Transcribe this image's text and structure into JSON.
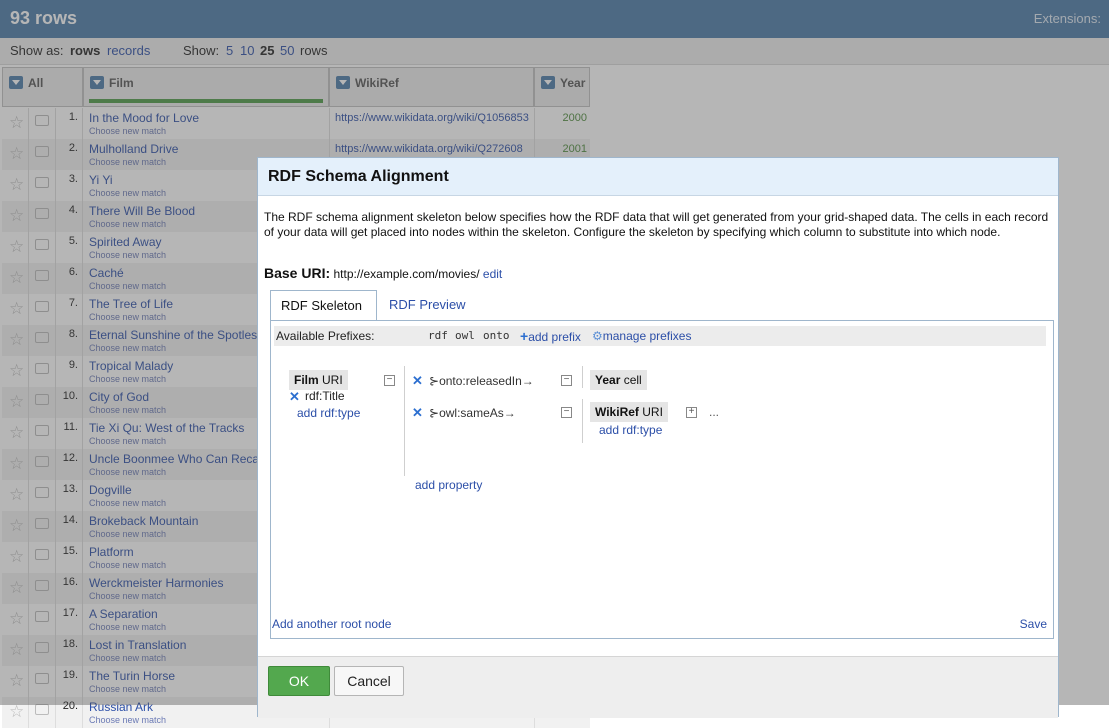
{
  "header": {
    "row_count": "93 rows",
    "extensions": "Extensions:"
  },
  "showbar": {
    "show_as_label": "Show as:",
    "rows_label": "rows",
    "records_label": "records",
    "show_label": "Show:",
    "page_sizes": [
      "5",
      "10",
      "25",
      "50"
    ],
    "rows_suffix": "rows"
  },
  "columns": {
    "all": "All",
    "film": "Film",
    "wikiref": "WikiRef",
    "year": "Year"
  },
  "match_label": "Choose new match",
  "rows": [
    {
      "n": "1.",
      "film": "In the Mood for Love",
      "wiki": "https://www.wikidata.org/wiki/Q1056853",
      "year": "2000"
    },
    {
      "n": "2.",
      "film": "Mulholland Drive",
      "wiki": "https://www.wikidata.org/wiki/Q272608",
      "year": "2001"
    },
    {
      "n": "3.",
      "film": "Yi Yi",
      "wiki": "",
      "year": ""
    },
    {
      "n": "4.",
      "film": "There Will Be Blood",
      "wiki": "",
      "year": ""
    },
    {
      "n": "5.",
      "film": "Spirited Away",
      "wiki": "",
      "year": ""
    },
    {
      "n": "6.",
      "film": "Caché",
      "wiki": "",
      "year": ""
    },
    {
      "n": "7.",
      "film": "The Tree of Life",
      "wiki": "",
      "year": ""
    },
    {
      "n": "8.",
      "film": "Eternal Sunshine of the Spotless M",
      "wiki": "",
      "year": ""
    },
    {
      "n": "9.",
      "film": "Tropical Malady",
      "wiki": "",
      "year": ""
    },
    {
      "n": "10.",
      "film": "City of God",
      "wiki": "",
      "year": ""
    },
    {
      "n": "11.",
      "film": "Tie Xi Qu: West of the Tracks",
      "wiki": "",
      "year": ""
    },
    {
      "n": "12.",
      "film": "Uncle Boonmee Who Can Recall H",
      "wiki": "",
      "year": ""
    },
    {
      "n": "13.",
      "film": "Dogville",
      "wiki": "",
      "year": ""
    },
    {
      "n": "14.",
      "film": "Brokeback Mountain",
      "wiki": "",
      "year": ""
    },
    {
      "n": "15.",
      "film": "Platform",
      "wiki": "",
      "year": ""
    },
    {
      "n": "16.",
      "film": "Werckmeister Harmonies",
      "wiki": "",
      "year": ""
    },
    {
      "n": "17.",
      "film": "A Separation",
      "wiki": "",
      "year": ""
    },
    {
      "n": "18.",
      "film": "Lost in Translation",
      "wiki": "",
      "year": ""
    },
    {
      "n": "19.",
      "film": "The Turin Horse",
      "wiki": "",
      "year": ""
    },
    {
      "n": "20.",
      "film": "Russian Ark",
      "wiki": "",
      "year": ""
    }
  ],
  "dialog": {
    "title": "RDF Schema Alignment",
    "description": "The RDF schema alignment skeleton below specifies how the RDF data that will get generated from your grid-shaped data. The cells in each record of your data will get placed into nodes within the skeleton. Configure the skeleton by specifying which column to substitute into which node.",
    "base_uri_label": "Base URI:",
    "base_uri_value": "http://example.com/movies/",
    "edit_label": "edit",
    "tabs": [
      "RDF Skeleton",
      "RDF Preview"
    ],
    "prefixes_label": "Available Prefixes:",
    "prefixes": [
      "rdf",
      "owl",
      "onto"
    ],
    "add_prefix": "add prefix",
    "manage_prefixes": "manage prefixes",
    "root_node": {
      "column": "Film",
      "kind": "URI"
    },
    "root_type": "rdf:Title",
    "add_rdf_type": "add rdf:type",
    "properties": [
      "onto:releasedIn",
      "owl:sameAs"
    ],
    "targets": [
      {
        "column": "Year",
        "kind": "cell"
      },
      {
        "column": "WikiRef",
        "kind": "URI"
      }
    ],
    "ellipsis": "...",
    "add_property": "add property",
    "add_root_node": "Add another root node",
    "save": "Save",
    "ok": "OK",
    "cancel": "Cancel"
  }
}
